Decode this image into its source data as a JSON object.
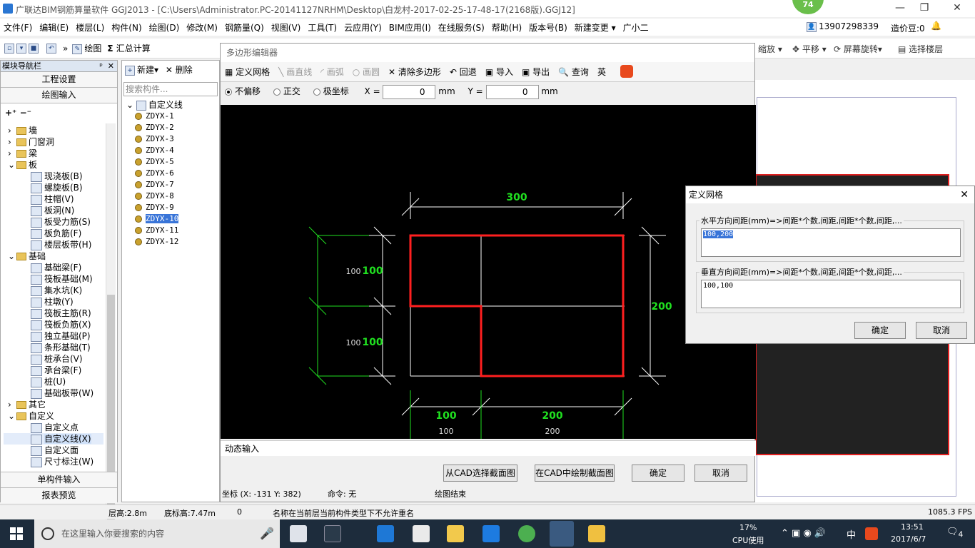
{
  "window": {
    "title": "广联达BIM钢筋算量软件 GGJ2013 - [C:\\Users\\Administrator.PC-20141127NRHM\\Desktop\\白龙村-2017-02-25-17-48-17(2168版).GGJ12]",
    "badge": "74",
    "min": "—",
    "max": "❐",
    "close": "✕"
  },
  "menubar": {
    "items": [
      "文件(F)",
      "编辑(E)",
      "楼层(L)",
      "构件(N)",
      "绘图(D)",
      "修改(M)",
      "钢筋量(Q)",
      "视图(V)",
      "工具(T)",
      "云应用(Y)",
      "BIM应用(I)",
      "在线服务(S)",
      "帮助(H)",
      "版本号(B)",
      "新建变更 ▾",
      "广小二"
    ],
    "phone": "13907298339",
    "price": "造价豆:0"
  },
  "toolbar": {
    "draw": "绘图",
    "sum": "汇总计算",
    "zoom": "缩放",
    "pan": "平移",
    "rotate": "屏幕旋转",
    "select_floor": "选择楼层"
  },
  "nav": {
    "title": "模块导航栏",
    "pin": "ᵖ",
    "close": "✕",
    "sections": [
      "工程设置",
      "绘图输入"
    ],
    "tree": [
      {
        "label": "墙",
        "level": 0,
        "type": "folder",
        "expand": "›"
      },
      {
        "label": "门窗洞",
        "level": 0,
        "type": "folder",
        "expand": "›"
      },
      {
        "label": "梁",
        "level": 0,
        "type": "folder",
        "expand": "›"
      },
      {
        "label": "板",
        "level": 0,
        "type": "folder",
        "expand": "⌄"
      },
      {
        "label": "现浇板(B)",
        "level": 1,
        "type": "item"
      },
      {
        "label": "螺旋板(B)",
        "level": 1,
        "type": "item"
      },
      {
        "label": "柱帽(V)",
        "level": 1,
        "type": "item"
      },
      {
        "label": "板洞(N)",
        "level": 1,
        "type": "item"
      },
      {
        "label": "板受力筋(S)",
        "level": 1,
        "type": "item"
      },
      {
        "label": "板负筋(F)",
        "level": 1,
        "type": "item"
      },
      {
        "label": "楼层板带(H)",
        "level": 1,
        "type": "item"
      },
      {
        "label": "基础",
        "level": 0,
        "type": "folder",
        "expand": "⌄"
      },
      {
        "label": "基础梁(F)",
        "level": 1,
        "type": "item"
      },
      {
        "label": "筏板基础(M)",
        "level": 1,
        "type": "item"
      },
      {
        "label": "集水坑(K)",
        "level": 1,
        "type": "item"
      },
      {
        "label": "柱墩(Y)",
        "level": 1,
        "type": "item"
      },
      {
        "label": "筏板主筋(R)",
        "level": 1,
        "type": "item"
      },
      {
        "label": "筏板负筋(X)",
        "level": 1,
        "type": "item"
      },
      {
        "label": "独立基础(P)",
        "level": 1,
        "type": "item"
      },
      {
        "label": "条形基础(T)",
        "level": 1,
        "type": "item"
      },
      {
        "label": "桩承台(V)",
        "level": 1,
        "type": "item"
      },
      {
        "label": "承台梁(F)",
        "level": 1,
        "type": "item"
      },
      {
        "label": "桩(U)",
        "level": 1,
        "type": "item"
      },
      {
        "label": "基础板带(W)",
        "level": 1,
        "type": "item"
      },
      {
        "label": "其它",
        "level": 0,
        "type": "folder",
        "expand": "›"
      },
      {
        "label": "自定义",
        "level": 0,
        "type": "folder",
        "expand": "⌄"
      },
      {
        "label": "自定义点",
        "level": 1,
        "type": "item"
      },
      {
        "label": "自定义线(X)",
        "level": 1,
        "type": "item",
        "selected": true
      },
      {
        "label": "自定义面",
        "level": 1,
        "type": "item"
      },
      {
        "label": "尺寸标注(W)",
        "level": 1,
        "type": "item"
      }
    ],
    "footer": [
      "单构件输入",
      "报表预览"
    ]
  },
  "components": {
    "new": "新建",
    "delete": "删除",
    "search_placeholder": "搜索构件...",
    "root": "自定义线",
    "items": [
      "ZDYX-1",
      "ZDYX-2",
      "ZDYX-3",
      "ZDYX-4",
      "ZDYX-5",
      "ZDYX-6",
      "ZDYX-7",
      "ZDYX-8",
      "ZDYX-9",
      "ZDYX-10",
      "ZDYX-11",
      "ZDYX-12"
    ],
    "selected": "ZDYX-10"
  },
  "poly_editor": {
    "title": "多边形编辑器",
    "close": "✕",
    "tools": [
      "定义网格",
      "画直线",
      "画弧",
      "画圆",
      "清除多边形",
      "回退",
      "导入",
      "导出",
      "查询",
      "英"
    ],
    "options": {
      "free": "不偏移",
      "ortho": "正交",
      "polar": "极坐标",
      "x_label": "X =",
      "x_value": "0",
      "y_label": "Y =",
      "y_value": "0",
      "unit": "mm"
    },
    "dims": {
      "top": "300",
      "right": "200",
      "left_top_small": "100",
      "left_top": "100",
      "left_bot_small": "100",
      "left_bot": "100",
      "bot_a": "100",
      "bot_b": "200",
      "bot_a_small": "100",
      "bot_b_small": "200"
    },
    "dynamic_input": "动态输入",
    "buttons": {
      "from_cad": "从CAD选择截面图",
      "draw_cad": "在CAD中绘制截面图",
      "ok": "确定",
      "cancel": "取消"
    },
    "status": {
      "coord": "坐标 (X: -131 Y: 382)",
      "cmd": "命令: 无",
      "msg": "绘图结束"
    }
  },
  "grid_dialog": {
    "title": "定义网格",
    "close": "✕",
    "h_label": "水平方向间距(mm)=>间距*个数,间距,间距*个数,间距,...",
    "h_value": "100,200",
    "v_label": "垂直方向间距(mm)=>间距*个数,间距,间距*个数,间距,...",
    "v_value": "100,100",
    "ok": "确定",
    "cancel": "取消"
  },
  "statusbar": {
    "floor_h": "层高:2.8m",
    "base_h": "底标高:7.47m",
    "n": "0",
    "msg": "名称在当前层当前构件类型下不允许重名",
    "fps": "1085.3 FPS"
  },
  "taskbar": {
    "search": "在这里输入你要搜索的内容",
    "cpu_pct": "17%",
    "cpu_label": "CPU使用",
    "ime": "中",
    "time": "13:51",
    "date": "2017/6/7",
    "notif": "4"
  },
  "colors": {
    "accent": "#3874d8",
    "cad_red": "#ff1f1f",
    "cad_green": "#20e020",
    "badge": "#6abf4b"
  }
}
